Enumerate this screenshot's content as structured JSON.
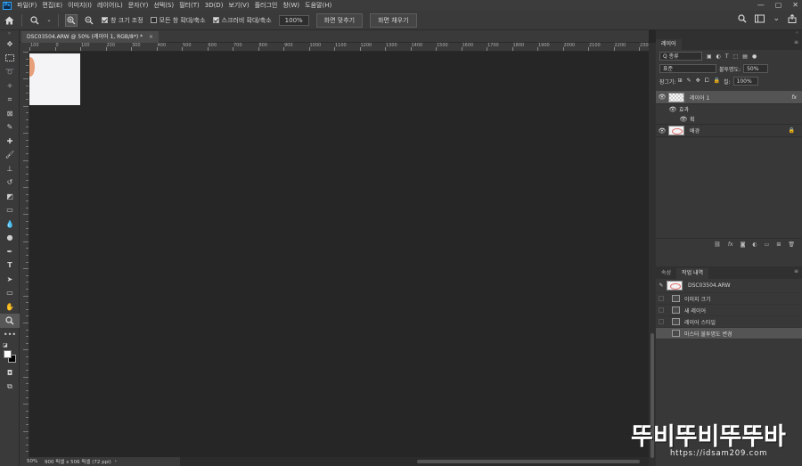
{
  "app": {
    "logo": "Ps"
  },
  "menu": [
    "파일(F)",
    "편집(E)",
    "이미지(I)",
    "레이어(L)",
    "문자(Y)",
    "선택(S)",
    "필터(T)",
    "3D(D)",
    "보기(V)",
    "플러그인",
    "창(W)",
    "도움말(H)"
  ],
  "window_controls": {
    "minimize": "—",
    "maximize": "▢",
    "close": "✕"
  },
  "options": {
    "resize_windows": "창 크기 조정",
    "zoom_all_windows": "모든 창 확대/축소",
    "scrubby_zoom": "스크러비 확대/축소",
    "zoom_value": "100%",
    "fit_screen": "화면 맞추기",
    "fill_screen": "화면 채우기"
  },
  "document": {
    "tab_title": "DSC03504.ARW @ 50% (레이어 1, RGB/8*) *",
    "close": "×"
  },
  "ruler": {
    "h_labels": [
      "100",
      "0",
      "100",
      "200",
      "300",
      "400",
      "500",
      "600",
      "700",
      "800",
      "900",
      "1000",
      "1100",
      "1200",
      "1300",
      "1400",
      "1500",
      "1600",
      "1700",
      "1800",
      "1900",
      "2000",
      "2100",
      "2200",
      "2300"
    ]
  },
  "status": {
    "zoom": "50%",
    "doc_size": "900 픽셀 x 506 픽셀 (72 ppi)",
    "arrow": "›"
  },
  "layers_panel": {
    "tab": "레이어",
    "menu": "≡",
    "filter_label": "Q 종류",
    "blend_mode": "표준",
    "opacity_label": "불투명도:",
    "opacity_value": "50%",
    "lock_label": "잠그기:",
    "fill_label": "칠:",
    "fill_value": "100%",
    "layers": [
      {
        "name": "레이어 1",
        "fx": "fx"
      },
      {
        "name": "배경"
      }
    ],
    "effects_label": "효과",
    "effect_stroke": "획"
  },
  "history_panel": {
    "tabs": [
      "속성",
      "작업 내역"
    ],
    "snapshot": "DSC03504.ARW",
    "items": [
      "이미지 크기",
      "새 레이어",
      "레이어 스타일",
      "마스터 불투명도 변경"
    ],
    "selected_index": 3
  },
  "watermark": {
    "logo": "뚜비뚜비뚜뚜바",
    "url": "https://idsam209.com"
  },
  "colors": {
    "accent": "#31a8ff",
    "panel": "#383838",
    "canvas": "#262626"
  }
}
